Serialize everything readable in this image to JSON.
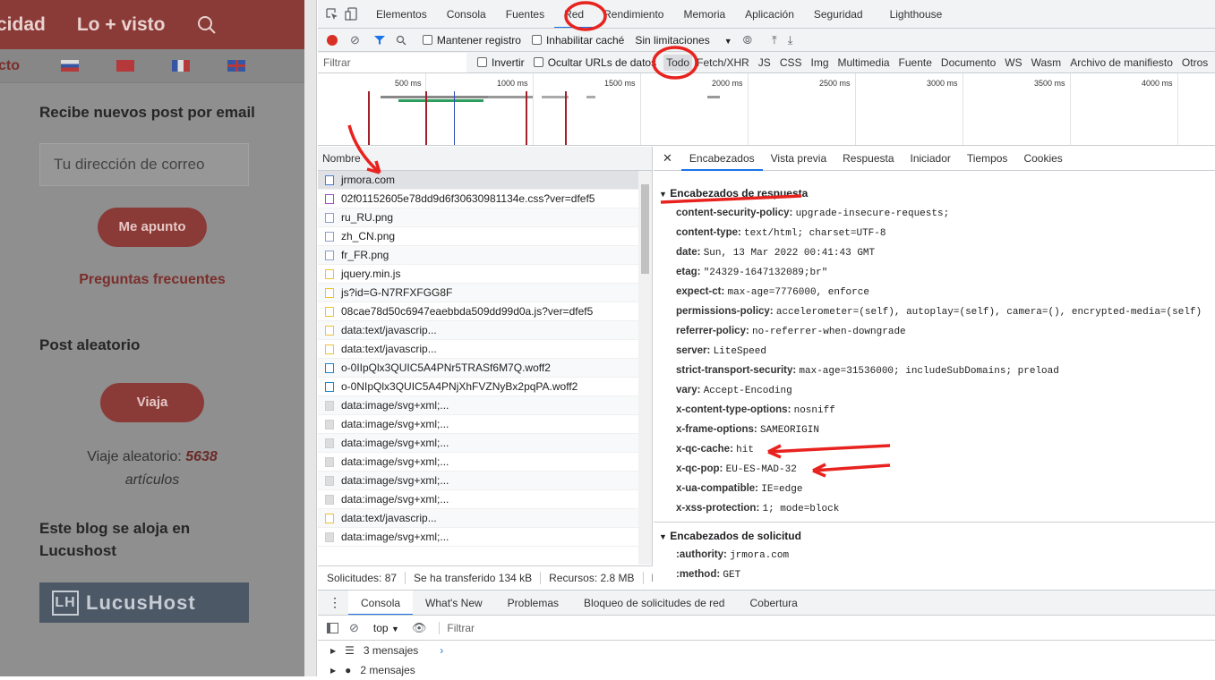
{
  "blog": {
    "nav": [
      "cidad",
      "Lo + visto"
    ],
    "lang_text": "cto",
    "subscribe_title": "Recibe nuevos post por email",
    "email_placeholder": "Tu dirección de correo",
    "subscribe_btn": "Me apunto",
    "faq": "Preguntas frecuentes",
    "random_title": "Post aleatorio",
    "random_btn": "Viaja",
    "random_text": "Viaje aleatorio:",
    "random_count": "5638",
    "random_unit": "artículos",
    "host_title": "Este blog se aloja en Lucushost",
    "host_logo": "LucusHost"
  },
  "devtools": {
    "tabs": [
      "Elementos",
      "Consola",
      "Fuentes",
      "Red",
      "Rendimiento",
      "Memoria",
      "Aplicación",
      "Seguridad",
      "Lighthouse"
    ],
    "toolbar": {
      "preserve": "Mantener registro",
      "disable_cache": "Inhabilitar caché",
      "throttle": "Sin limitaciones"
    },
    "filter": {
      "placeholder": "Filtrar",
      "invert": "Invertir",
      "hide_urls": "Ocultar URLs de datos",
      "types": [
        "Todo",
        "Fetch/XHR",
        "JS",
        "CSS",
        "Img",
        "Multimedia",
        "Fuente",
        "Documento",
        "WS",
        "Wasm",
        "Archivo de manifiesto",
        "Otros"
      ]
    },
    "timeline_labels": [
      "500 ms",
      "1000 ms",
      "1500 ms",
      "2000 ms",
      "2500 ms",
      "3000 ms",
      "3500 ms",
      "4000 ms"
    ],
    "list_header": "Nombre",
    "requests": [
      {
        "name": "jrmora.com",
        "type": "doc"
      },
      {
        "name": "02f01152605e78dd9d6f30630981134e.css?ver=dfef5",
        "type": "css"
      },
      {
        "name": "ru_RU.png",
        "type": "img"
      },
      {
        "name": "zh_CN.png",
        "type": "img"
      },
      {
        "name": "fr_FR.png",
        "type": "img"
      },
      {
        "name": "jquery.min.js",
        "type": "js"
      },
      {
        "name": "js?id=G-N7RFXFGG8F",
        "type": "js"
      },
      {
        "name": "08cae78d50c6947eaebbda509dd99d0a.js?ver=dfef5",
        "type": "js"
      },
      {
        "name": "data:text/javascrip...",
        "type": "js"
      },
      {
        "name": "data:text/javascrip...",
        "type": "js"
      },
      {
        "name": "o-0IIpQlx3QUIC5A4PNr5TRASf6M7Q.woff2",
        "type": "font"
      },
      {
        "name": "o-0NIpQlx3QUIC5A4PNjXhFVZNyBx2pqPA.woff2",
        "type": "font"
      },
      {
        "name": "data:image/svg+xml;...",
        "type": "svg"
      },
      {
        "name": "data:image/svg+xml;...",
        "type": "svg"
      },
      {
        "name": "data:image/svg+xml;...",
        "type": "svg"
      },
      {
        "name": "data:image/svg+xml;...",
        "type": "svg"
      },
      {
        "name": "data:image/svg+xml;...",
        "type": "svg"
      },
      {
        "name": "data:image/svg+xml;...",
        "type": "svg"
      },
      {
        "name": "data:text/javascrip...",
        "type": "js"
      },
      {
        "name": "data:image/svg+xml;...",
        "type": "svg"
      }
    ],
    "status": [
      "Solicitudes: 87",
      "Se ha transferido 134 kB",
      "Recursos: 2.8 MB",
      "Fi"
    ],
    "detail_tabs": [
      "Encabezados",
      "Vista previa",
      "Respuesta",
      "Iniciador",
      "Tiempos",
      "Cookies"
    ],
    "response_title": "Encabezados de respuesta",
    "response_headers": [
      {
        "k": "content-security-policy:",
        "v": "upgrade-insecure-requests;"
      },
      {
        "k": "content-type:",
        "v": "text/html; charset=UTF-8"
      },
      {
        "k": "date:",
        "v": "Sun, 13 Mar 2022 00:41:43 GMT"
      },
      {
        "k": "etag:",
        "v": "\"24329-1647132089;br\""
      },
      {
        "k": "expect-ct:",
        "v": "max-age=7776000, enforce"
      },
      {
        "k": "permissions-policy:",
        "v": "accelerometer=(self), autoplay=(self), camera=(), encrypted-media=(self)"
      },
      {
        "k": "referrer-policy:",
        "v": "no-referrer-when-downgrade"
      },
      {
        "k": "server:",
        "v": "LiteSpeed"
      },
      {
        "k": "strict-transport-security:",
        "v": "max-age=31536000; includeSubDomains; preload"
      },
      {
        "k": "vary:",
        "v": "Accept-Encoding"
      },
      {
        "k": "x-content-type-options:",
        "v": "nosniff"
      },
      {
        "k": "x-frame-options:",
        "v": "SAMEORIGIN"
      },
      {
        "k": "x-qc-cache:",
        "v": "hit"
      },
      {
        "k": "x-qc-pop:",
        "v": "EU-ES-MAD-32"
      },
      {
        "k": "x-ua-compatible:",
        "v": "IE=edge"
      },
      {
        "k": "x-xss-protection:",
        "v": "1; mode=block"
      }
    ],
    "request_title": "Encabezados de solicitud",
    "request_headers": [
      {
        "k": ":authority:",
        "v": "jrmora.com"
      },
      {
        "k": ":method:",
        "v": "GET"
      }
    ],
    "drawer_tabs": [
      "Consola",
      "What's New",
      "Problemas",
      "Bloqueo de solicitudes de red",
      "Cobertura"
    ],
    "drawer": {
      "context": "top",
      "filter": "Filtrar",
      "msg1": "3 mensajes",
      "msg2": "2 mensajes"
    }
  },
  "colors": {
    "annotation": "#e8231f",
    "accent": "#1a73e8",
    "brand": "#8a3a37"
  }
}
